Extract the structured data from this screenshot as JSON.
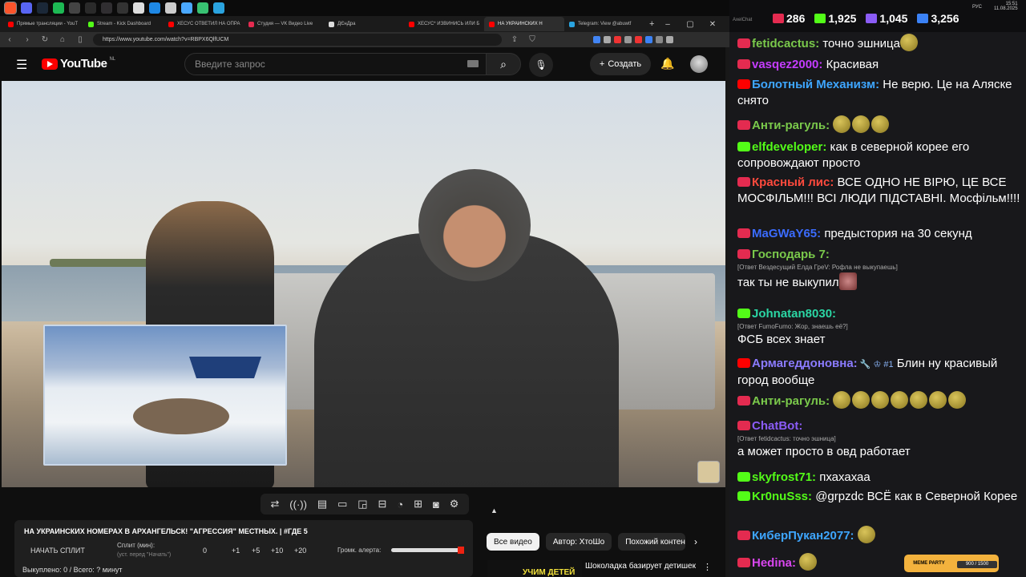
{
  "taskbar": {
    "apps": [
      {
        "name": "brave-icon",
        "color": "#fb542b"
      },
      {
        "name": "discord-icon",
        "color": "#5865f2"
      },
      {
        "name": "steam-icon",
        "color": "#1b2838"
      },
      {
        "name": "spotify-icon",
        "color": "#1db954"
      },
      {
        "name": "app-icon",
        "color": "#444"
      },
      {
        "name": "chrome-icon",
        "color": "#2a2a2a"
      },
      {
        "name": "obs-icon",
        "color": "#302e31"
      },
      {
        "name": "app-icon",
        "color": "#333"
      },
      {
        "name": "app-icon",
        "color": "#ddd"
      },
      {
        "name": "app-icon",
        "color": "#1e88e5"
      },
      {
        "name": "app-icon",
        "color": "#ccc"
      },
      {
        "name": "app-icon",
        "color": "#4aa8ff"
      },
      {
        "name": "app-icon",
        "color": "#38c172"
      },
      {
        "name": "telegram-icon",
        "color": "#2aa3df"
      }
    ]
  },
  "browser": {
    "tabs": [
      {
        "label": "Прямые трансляции - YouT",
        "fav": "#ff0000",
        "active": false
      },
      {
        "label": "Stream - Kick Dashboard",
        "fav": "#53fc18",
        "active": false
      },
      {
        "label": "ХЕСУС ОТВЕТИЛ НА ОПРА",
        "fav": "#ff0000",
        "active": false
      },
      {
        "label": "Студия — VK Видео Live",
        "fav": "#e42b50",
        "active": false
      },
      {
        "label": "ДЄнДра",
        "fav": "#ddd",
        "active": false
      },
      {
        "label": "ХЕСУС* ИЗВИНИСЬ ИЛИ Б",
        "fav": "#ff0000",
        "active": false
      },
      {
        "label": "НА УКРАИНСКИХ Н",
        "fav": "#ff0000",
        "active": true
      },
      {
        "label": "Telegram: View @abuwtf",
        "fav": "#2aa3df",
        "active": false
      }
    ],
    "new_tab": "+",
    "url": "https://www.youtube.com/watch?v=RBPX6QlfUCM"
  },
  "youtube": {
    "logo_text": "YouTube",
    "country": "NL",
    "search_placeholder": "Введите запрос",
    "create_label": "Создать",
    "controls_hint": "⇄"
  },
  "info": {
    "title": "НА УКРАИНСКИХ НОМЕРАХ В АРХАНГЕЛЬСК! \"АГРЕССИЯ\" МЕСТНЫХ. | #ГДЕ 5",
    "start_split": "НАЧАТЬ СПЛИТ",
    "split_label": "Сплит (мин):",
    "split_sub": "(уст. перед \"Начать\")",
    "split_value": "0",
    "increments": [
      "+1",
      "+5",
      "+10",
      "+20"
    ],
    "alert_label": "Громк. алерта:",
    "alert_volume": 1.0,
    "bought": "Выкуплено: 0 / Всего: ? минут"
  },
  "chips": [
    "Все видео",
    "Автор: ХтоШо",
    "Похожий контент"
  ],
  "next_video": {
    "thumb_text": "УЧИМ ДЕТЕЙ",
    "title": "Шоколадка базирует детишек"
  },
  "chat": {
    "app_label": "AxelChat",
    "viewers": [
      {
        "icon": "vk",
        "color": "#e42b50",
        "count": "286"
      },
      {
        "icon": "kick",
        "color": "#53fc18",
        "count": "1,925"
      },
      {
        "icon": "vk-live",
        "color": "#8b5cf6",
        "count": "1,045"
      },
      {
        "icon": "viewers",
        "color": "#3b82f6",
        "count": "3,256"
      }
    ],
    "clock_time": "15:51",
    "clock_date": "11.08.2025",
    "lang": "РУС",
    "messages": [
      {
        "badge": "vk",
        "nick": "fetidcactus:",
        "nick_color": "#7ac94b",
        "text": "точно эшница",
        "emotes": 1
      },
      {
        "badge": "vk",
        "nick": "vasqez2000:",
        "nick_color": "#c53cff",
        "text": "Красивая",
        "emotes": 0
      },
      {
        "badge": "yt",
        "nick": "Болотный Механизм:",
        "nick_color": "#3ea6ff",
        "text": "Не верю. Це на Аляске снято",
        "emotes": 0
      },
      {
        "badge": "vk",
        "nick": "Анти-рагуль:",
        "nick_color": "#7ac94b",
        "text": "",
        "emotes": 3
      },
      {
        "badge": "kick",
        "nick": "elfdeveloper:",
        "nick_color": "#53fc18",
        "text": "как в северной корее его сопровождают просто",
        "emotes": 0
      },
      {
        "badge": "vk",
        "nick": "Красный лис:",
        "nick_color": "#ff4a3d",
        "text": "ВСЕ ОДНО НЕ ВІРЮ, ЦЕ ВСЕ МОСФІЛЬМ!!! ВСІ ЛЮДИ ПІДСТАВНІ. Мосфільм!!!!",
        "emotes": 0
      },
      {
        "badge": "vk",
        "nick": "MaGWaY65:",
        "nick_color": "#3b6cff",
        "text": "предыстория на 30 секунд",
        "emotes": 0
      },
      {
        "badge": "vk",
        "nick": "Господарь 7:",
        "nick_color": "#7ac94b",
        "reply": "[Ответ Вездесущий Елда ГреV: Рофла не выкупаешь]",
        "text": "так ты не выкупил",
        "emotes": 1
      },
      {
        "badge": "kick",
        "nick": "Johnatan8030:",
        "nick_color": "#2bd6a4",
        "reply": "[Ответ FumoFumo: Жор, знаешь её?]",
        "text": "ФСБ всех знает",
        "emotes": 0
      },
      {
        "badge": "yt",
        "nick": "Армагеддоновна:",
        "nick_color": "#8b7bff",
        "badge_extra": "🔧 ♔ #1",
        "text": "Блин ну красивый город вообще",
        "emotes": 0
      },
      {
        "badge": "vk",
        "nick": "Анти-рагуль:",
        "nick_color": "#7ac94b",
        "text": "",
        "emotes": 7
      },
      {
        "badge": "vk",
        "nick": "ChatBot:",
        "nick_color": "#8b5cf6",
        "reply": "[Ответ fetidcactus: точно эшница]",
        "text": "а может просто в овд работает",
        "emotes": 0
      },
      {
        "badge": "kick",
        "nick": "skyfrost71:",
        "nick_color": "#53fc18",
        "text": "пхахахаа",
        "emotes": 0
      },
      {
        "badge": "kick",
        "nick": "Kr0nuSss:",
        "nick_color": "#53fc18",
        "text": "@grpzdc ВСЁ как в Северной Корее",
        "emotes": 0
      },
      {
        "badge": "vk",
        "nick": "КиберПукан2077:",
        "nick_color": "#3ea6ff",
        "text": "",
        "emotes": 1
      },
      {
        "badge": "vk",
        "nick": "Hedina:",
        "nick_color": "#d946ef",
        "text": "",
        "emotes": 1
      }
    ],
    "meme_party": "MEME PARTY",
    "meme_progress": "900 / 1500"
  }
}
